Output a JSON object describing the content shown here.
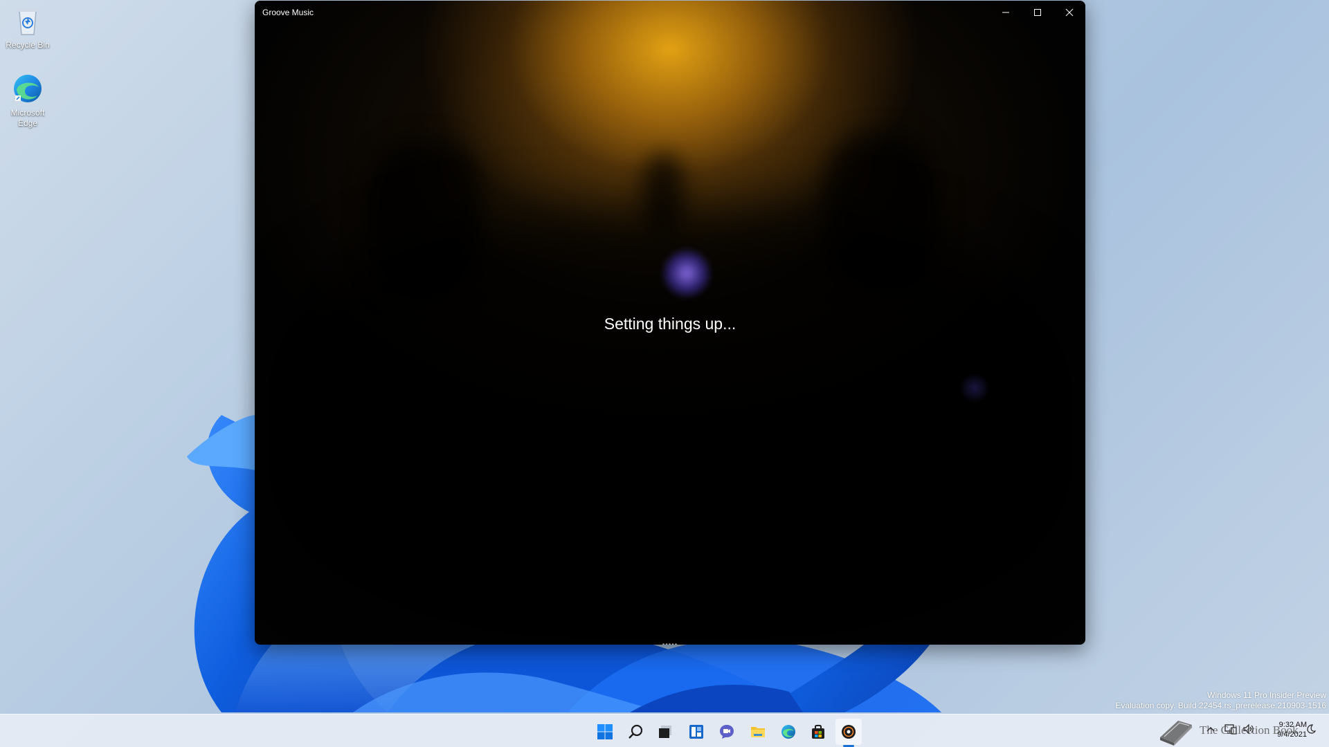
{
  "desktop": {
    "icons": [
      {
        "label": "Recycle Bin",
        "icon": "recycle-bin-icon"
      },
      {
        "label": "Microsoft Edge",
        "icon": "edge-icon"
      }
    ],
    "watermark": {
      "line1": "Windows 11 Pro Insider Preview",
      "line2": "Evaluation copy. Build 22454.rs_prerelease.210903-1516"
    }
  },
  "window": {
    "title": "Groove Music",
    "status": "Setting things up...",
    "controls": {
      "minimize": "minimize-icon",
      "maximize": "maximize-icon",
      "close": "close-icon"
    }
  },
  "taskbar": {
    "apps": [
      {
        "name": "start",
        "icon": "windows-logo-icon"
      },
      {
        "name": "search",
        "icon": "search-icon"
      },
      {
        "name": "task-view",
        "icon": "task-view-icon"
      },
      {
        "name": "widgets",
        "icon": "widgets-icon"
      },
      {
        "name": "chat",
        "icon": "chat-icon"
      },
      {
        "name": "file-explorer",
        "icon": "folder-icon"
      },
      {
        "name": "edge",
        "icon": "edge-icon"
      },
      {
        "name": "store",
        "icon": "store-icon"
      },
      {
        "name": "groove-music",
        "icon": "groove-music-icon",
        "active": true
      }
    ],
    "tray": {
      "time": "9:32 AM",
      "date": "9/4/2021"
    },
    "overlay_text": "The Collection Book"
  },
  "colors": {
    "accent": "#1a6fd6",
    "window_bg": "#000000",
    "glow": "#eca814"
  }
}
